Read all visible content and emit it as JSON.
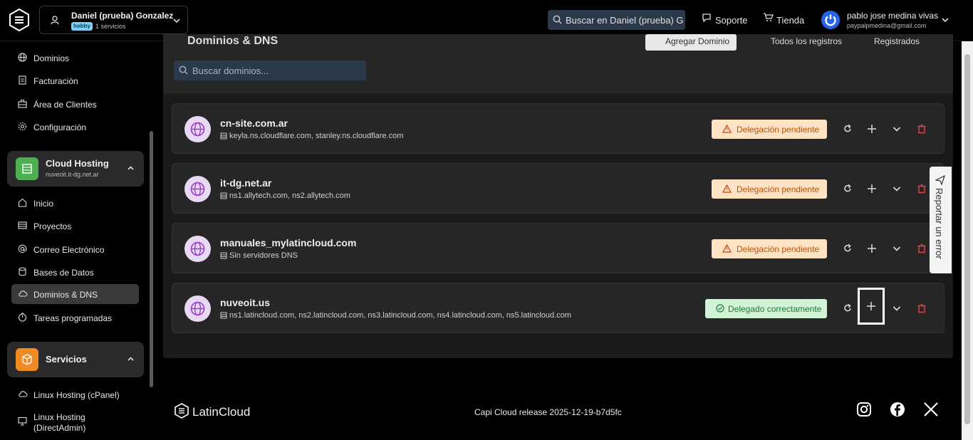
{
  "account": {
    "name": "Daniel (prueba) Gonzalez",
    "plan": "hobby",
    "services": "1 servicios"
  },
  "topbar": {
    "search_text": "Buscar en Daniel (prueba) G",
    "support": "Soporte",
    "store": "Tienda",
    "user_name": "pablo jose medina vivas",
    "user_email": "paypalpmedina@gmail.com"
  },
  "sidebar": {
    "top_items": [
      {
        "label": "Dominios",
        "icon": "globe-icon"
      },
      {
        "label": "Facturación",
        "icon": "document-icon"
      },
      {
        "label": "Área de Clientes",
        "icon": "briefcase-icon"
      },
      {
        "label": "Configuración",
        "icon": "gear-icon"
      }
    ],
    "cloud": {
      "title": "Cloud Hosting",
      "subtitle": "nuveoit.it-dg.net.ar",
      "color": "#4caf50"
    },
    "cloud_items": [
      {
        "label": "Inicio",
        "icon": "home-icon"
      },
      {
        "label": "Proyectos",
        "icon": "list-icon"
      },
      {
        "label": "Correo Electrónico",
        "icon": "at-icon"
      },
      {
        "label": "Bases de Datos",
        "icon": "database-icon"
      },
      {
        "label": "Dominios & DNS",
        "icon": "cloud-icon"
      },
      {
        "label": "Tareas programadas",
        "icon": "timer-icon"
      }
    ],
    "services": {
      "title": "Servicios",
      "color": "#f08a24"
    },
    "service_items": [
      {
        "label": "Linux Hosting (cPanel)",
        "icon": "cloud-icon"
      },
      {
        "label": "Linux Hosting",
        "label2": "(DirectAdmin)",
        "icon": "monitor-icon"
      }
    ]
  },
  "main": {
    "title": "Dominios & DNS",
    "add_domain": "Agregar Dominio",
    "all_records": "Todos los registros",
    "registered": "Registrados",
    "search_placeholder": "Buscar dominios..."
  },
  "domains": [
    {
      "name": "cn-site.com.ar",
      "dns": "keyla.ns.cloudflare.com, stanley.ns.cloudflare.com",
      "status": "Delegación pendiente"
    },
    {
      "name": "it-dg.net.ar",
      "dns": "ns1.allytech.com, ns2.allytech.com",
      "status": "Delegación pendiente"
    },
    {
      "name": "manuales_mylatincloud.com",
      "dns": "Sin servidores DNS",
      "status": "Delegación pendiente"
    },
    {
      "name": "nuveoit.us",
      "dns": "ns1.latincloud.com, ns2.latincloud.com, ns3.latincloud.com, ns4.latincloud.com, ns5.latincloud.com",
      "status": "Delegado correctamente"
    }
  ],
  "report": "Reportar un error",
  "footer": {
    "brand": "LatinCloud",
    "release": "Capi Cloud release 2025-12-19-b7d5fc"
  },
  "colors": {
    "pending_bg": "#fde3c3",
    "ok_bg": "#d1f2d4",
    "delete": "#e0464b",
    "globe_bg": "#e9d8f4"
  }
}
